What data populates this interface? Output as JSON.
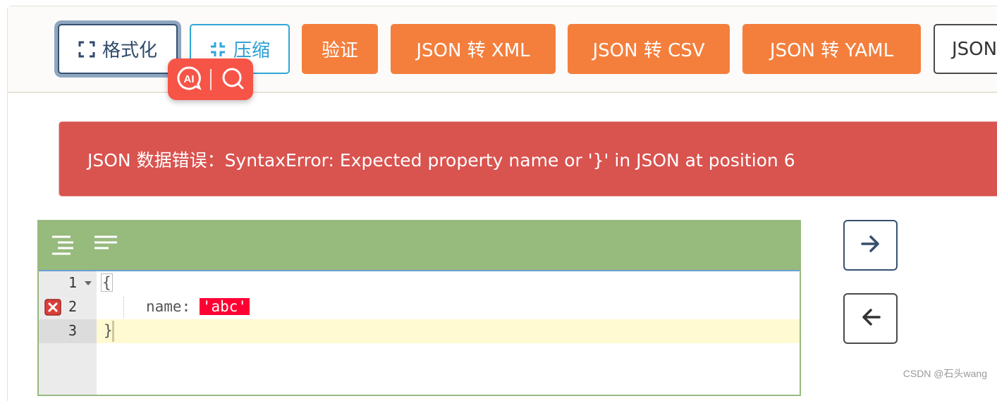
{
  "toolbar": {
    "format_label": "格式化",
    "compress_label": "压缩",
    "validate_label": "验证",
    "to_xml_label": "JSON 转 XML",
    "to_csv_label": "JSON 转 CSV",
    "to_yaml_label": "JSON 转 YAML",
    "more_label": "JSON"
  },
  "ai_badge": {
    "icons": [
      "ai-icon",
      "search-icon"
    ]
  },
  "error": {
    "message": "JSON 数据错误：SyntaxError: Expected property name or '}' in JSON at position 6"
  },
  "editor": {
    "menu_icons": [
      "format-indent-icon",
      "compact-icon"
    ],
    "lines": [
      {
        "number": "1",
        "text": "{",
        "foldable": true,
        "error": false
      },
      {
        "number": "2",
        "key": "name: ",
        "value": "'abc'",
        "error": true
      },
      {
        "number": "3",
        "text": "}",
        "foldable": false,
        "error": false,
        "active": true
      }
    ]
  },
  "side_buttons": {
    "icons": [
      "arrow-right-icon",
      "arrow-left-icon"
    ]
  },
  "watermark": "CSDN @石头wang",
  "colors": {
    "orange": "#f47f3d",
    "error_red": "#d9534f",
    "editor_green": "#97ba7d",
    "invalid_token": "#ff0033",
    "active_line": "#fffad1"
  }
}
